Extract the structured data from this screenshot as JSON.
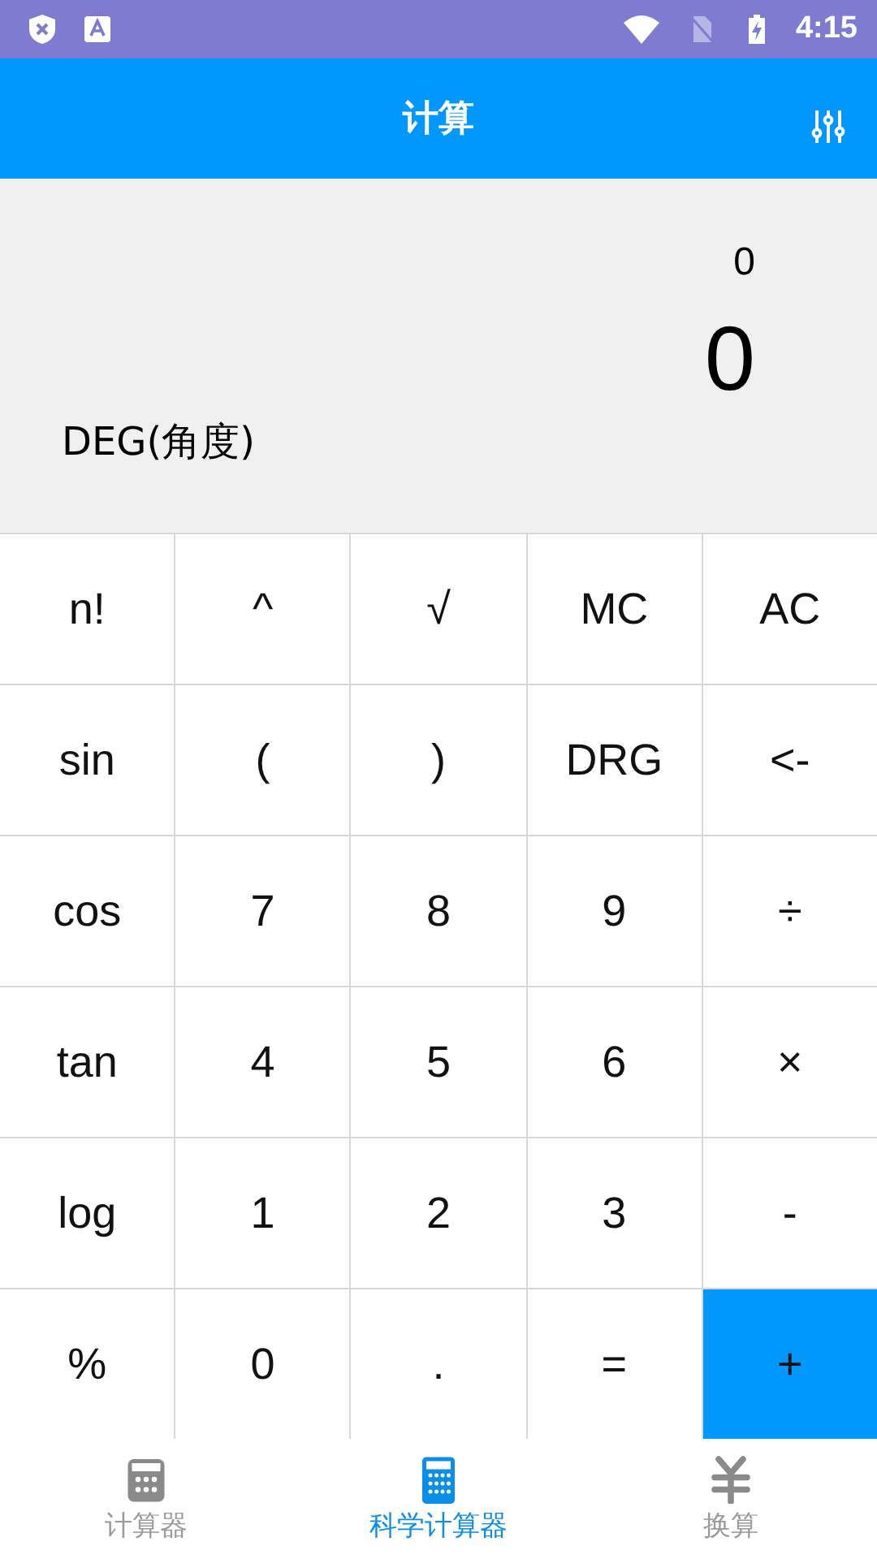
{
  "status_bar": {
    "time": "4:15"
  },
  "app_bar": {
    "title": "计算"
  },
  "display": {
    "expression": "0",
    "result": "0",
    "angle_mode": "DEG(角度)"
  },
  "keys": [
    [
      {
        "label": "n!",
        "selected": false
      },
      {
        "label": "^",
        "selected": false
      },
      {
        "label": "√",
        "selected": false
      },
      {
        "label": "MC",
        "selected": false
      },
      {
        "label": "AC",
        "selected": false
      }
    ],
    [
      {
        "label": "sin",
        "selected": false
      },
      {
        "label": "(",
        "selected": false
      },
      {
        "label": ")",
        "selected": false
      },
      {
        "label": "DRG",
        "selected": false
      },
      {
        "label": "<-",
        "selected": false
      }
    ],
    [
      {
        "label": "cos",
        "selected": false
      },
      {
        "label": "7",
        "selected": false
      },
      {
        "label": "8",
        "selected": false
      },
      {
        "label": "9",
        "selected": false
      },
      {
        "label": "÷",
        "selected": false
      }
    ],
    [
      {
        "label": "tan",
        "selected": false
      },
      {
        "label": "4",
        "selected": false
      },
      {
        "label": "5",
        "selected": false
      },
      {
        "label": "6",
        "selected": false
      },
      {
        "label": "×",
        "selected": false
      }
    ],
    [
      {
        "label": "log",
        "selected": false
      },
      {
        "label": "1",
        "selected": false
      },
      {
        "label": "2",
        "selected": false
      },
      {
        "label": "3",
        "selected": false
      },
      {
        "label": "-",
        "selected": false
      }
    ],
    [
      {
        "label": "%",
        "selected": false
      },
      {
        "label": "0",
        "selected": false
      },
      {
        "label": ".",
        "selected": false
      },
      {
        "label": "=",
        "selected": false
      },
      {
        "label": "+",
        "selected": true
      }
    ]
  ],
  "bottom_nav": [
    {
      "label": "计算器",
      "kind": "calculator",
      "selected": false
    },
    {
      "label": "科学计算器",
      "kind": "scientific",
      "selected": true
    },
    {
      "label": "换算",
      "kind": "currency",
      "selected": false
    }
  ]
}
